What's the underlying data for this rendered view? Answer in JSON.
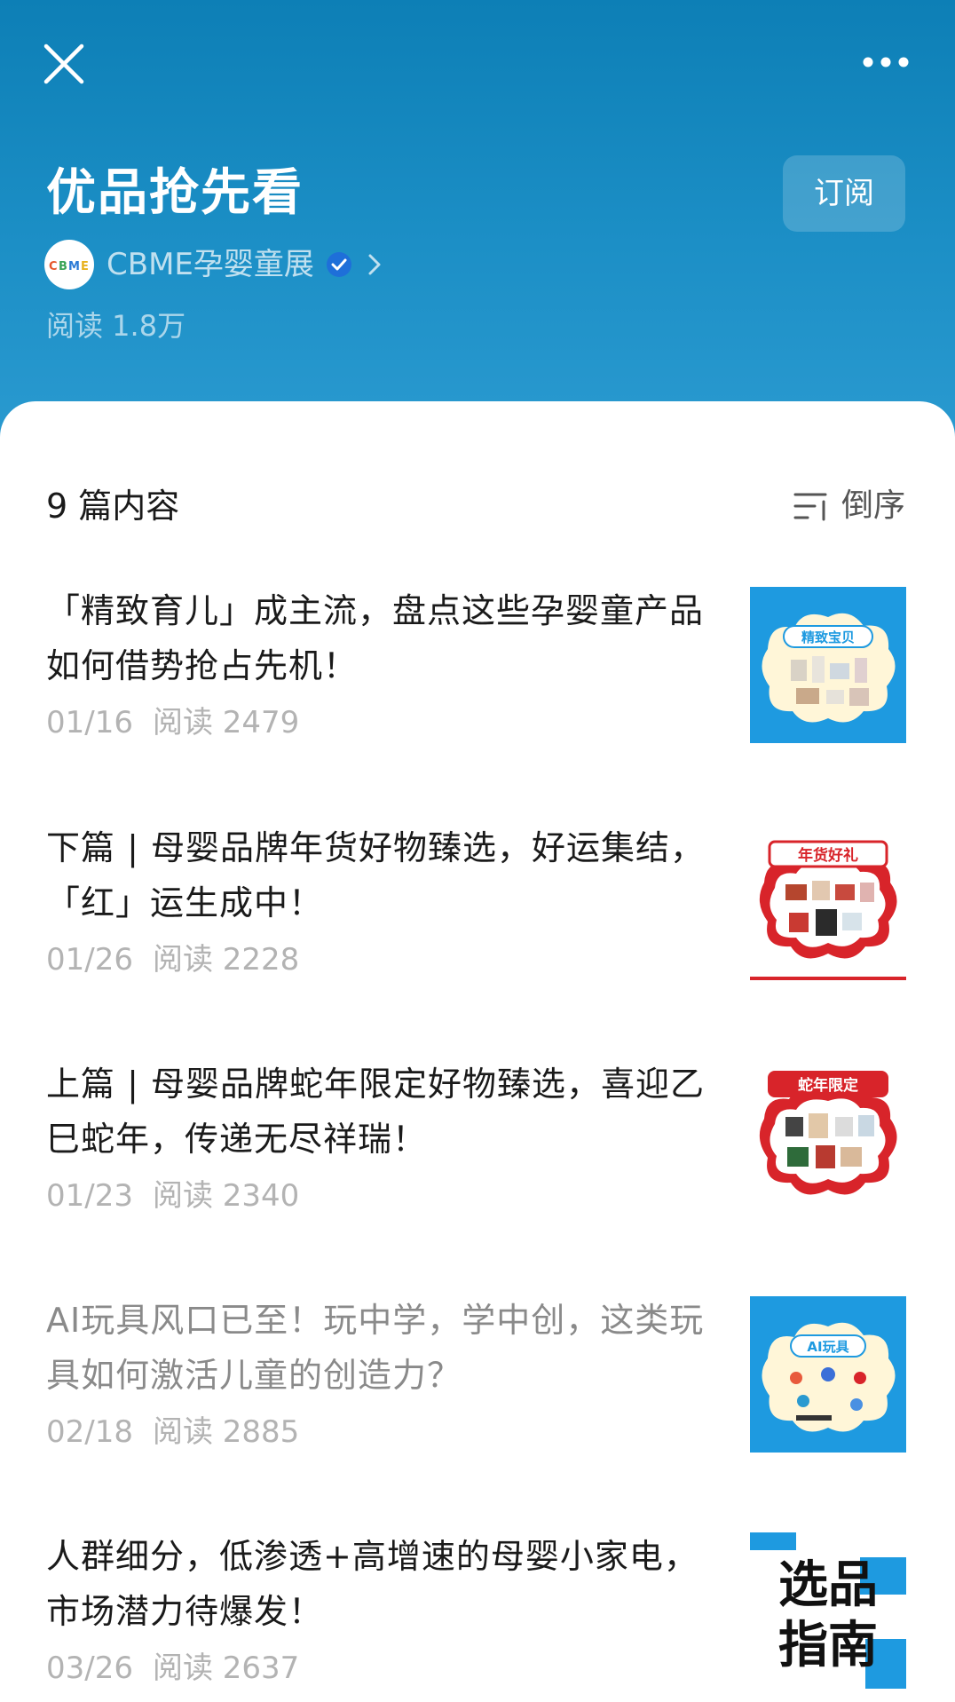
{
  "header": {
    "title": "优品抢先看",
    "subscribe_label": "订阅",
    "account_name": "CBME孕婴童展",
    "avatar_text": "CBME",
    "reads": "阅读 1.8万"
  },
  "list": {
    "count_label": "9 篇内容",
    "sort_label": "倒序",
    "items": [
      {
        "title": "「精致育儿」成主流，盘点这些孕婴童产品如何借势抢占先机！",
        "date": "01/16",
        "reads": "阅读 2479",
        "thumb_text": "精致宝贝",
        "read": false
      },
      {
        "title": "下篇 | 母婴品牌年货好物臻选，好运集结，「红」运生成中！",
        "date": "01/26",
        "reads": "阅读 2228",
        "thumb_text": "年货好礼",
        "read": false
      },
      {
        "title": "上篇 | 母婴品牌蛇年限定好物臻选，喜迎乙巳蛇年，传递无尽祥瑞！",
        "date": "01/23",
        "reads": "阅读 2340",
        "thumb_text": "蛇年限定",
        "read": false
      },
      {
        "title": "AI玩具风口已至！玩中学，学中创，这类玩具如何激活儿童的创造力？",
        "date": "02/18",
        "reads": "阅读 2885",
        "thumb_text": "AI玩具",
        "read": true
      },
      {
        "title": "人群细分，低渗透+高增速的母婴小家电，市场潜力待爆发！",
        "date": "03/26",
        "reads": "阅读 2637",
        "thumb_text_line1": "选品",
        "thumb_text_line2": "指南",
        "read": false
      }
    ]
  },
  "colors": {
    "header_top": "#0d7fb6",
    "header_bottom": "#2a9ad0",
    "thumb_blue": "#1e9ae0",
    "thumb_red": "#d8242a",
    "verified_blue": "#1e6fd9"
  },
  "icons": [
    "close-icon",
    "more-icon",
    "verified-icon",
    "chevron-right-icon",
    "sort-icon"
  ]
}
